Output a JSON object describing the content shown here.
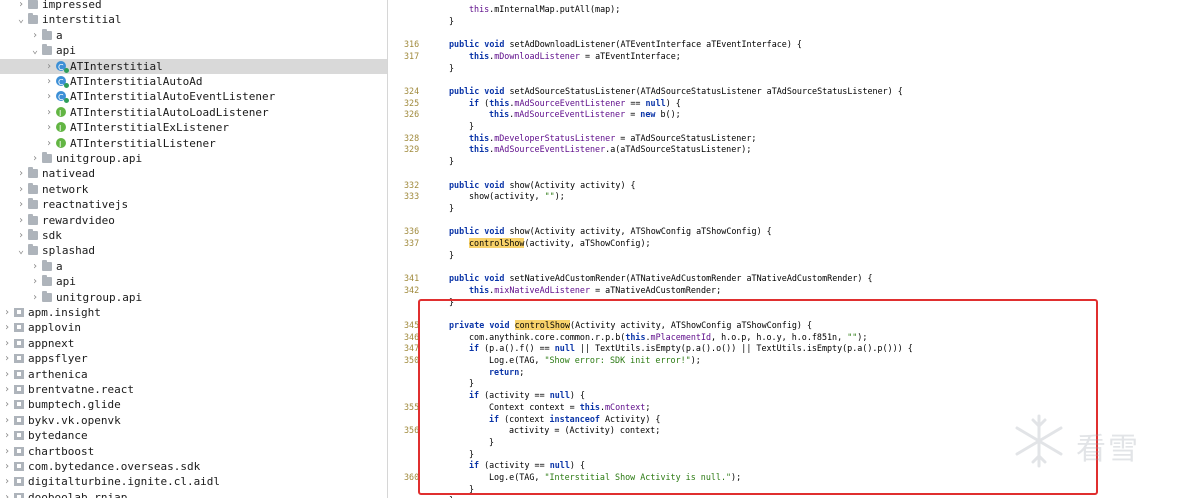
{
  "tree": {
    "rows": [
      {
        "label": "impressed",
        "indent": 1,
        "icon": "folder-icon",
        "chevron": ">"
      },
      {
        "label": "interstitial",
        "indent": 1,
        "icon": "folder-icon",
        "chevron": "v"
      },
      {
        "label": "a",
        "indent": 2,
        "icon": "folder-icon",
        "chevron": ">"
      },
      {
        "label": "api",
        "indent": 2,
        "icon": "folder-icon",
        "chevron": "v"
      },
      {
        "label": "ATInterstitial",
        "indent": 3,
        "icon": "class-icon",
        "chevron": ">",
        "selected": true
      },
      {
        "label": "ATInterstitialAutoAd",
        "indent": 3,
        "icon": "class-icon",
        "chevron": ">"
      },
      {
        "label": "ATInterstitialAutoEventListener",
        "indent": 3,
        "icon": "class-icon",
        "chevron": ">"
      },
      {
        "label": "ATInterstitialAutoLoadListener",
        "indent": 3,
        "icon": "interface-icon",
        "chevron": ">"
      },
      {
        "label": "ATInterstitialExListener",
        "indent": 3,
        "icon": "interface-icon",
        "chevron": ">"
      },
      {
        "label": "ATInterstitialListener",
        "indent": 3,
        "icon": "interface-icon",
        "chevron": ">"
      },
      {
        "label": "unitgroup.api",
        "indent": 2,
        "icon": "folder-icon",
        "chevron": ">"
      },
      {
        "label": "nativead",
        "indent": 1,
        "icon": "folder-icon",
        "chevron": ">"
      },
      {
        "label": "network",
        "indent": 1,
        "icon": "folder-icon",
        "chevron": ">"
      },
      {
        "label": "reactnativejs",
        "indent": 1,
        "icon": "folder-icon",
        "chevron": ">"
      },
      {
        "label": "rewardvideo",
        "indent": 1,
        "icon": "folder-icon",
        "chevron": ">"
      },
      {
        "label": "sdk",
        "indent": 1,
        "icon": "folder-icon",
        "chevron": ">"
      },
      {
        "label": "splashad",
        "indent": 1,
        "icon": "folder-icon",
        "chevron": "v"
      },
      {
        "label": "a",
        "indent": 2,
        "icon": "folder-icon",
        "chevron": ">"
      },
      {
        "label": "api",
        "indent": 2,
        "icon": "folder-icon",
        "chevron": ">"
      },
      {
        "label": "unitgroup.api",
        "indent": 2,
        "icon": "folder-icon",
        "chevron": ">"
      },
      {
        "label": "apm.insight",
        "indent": 0,
        "icon": "package-icon",
        "chevron": ">"
      },
      {
        "label": "applovin",
        "indent": 0,
        "icon": "package-icon",
        "chevron": ">"
      },
      {
        "label": "appnext",
        "indent": 0,
        "icon": "package-icon",
        "chevron": ">"
      },
      {
        "label": "appsflyer",
        "indent": 0,
        "icon": "package-icon",
        "chevron": ">"
      },
      {
        "label": "arthenica",
        "indent": 0,
        "icon": "package-icon",
        "chevron": ">"
      },
      {
        "label": "brentvatne.react",
        "indent": 0,
        "icon": "package-icon",
        "chevron": ">"
      },
      {
        "label": "bumptech.glide",
        "indent": 0,
        "icon": "package-icon",
        "chevron": ">"
      },
      {
        "label": "bykv.vk.openvk",
        "indent": 0,
        "icon": "package-icon",
        "chevron": ">"
      },
      {
        "label": "bytedance",
        "indent": 0,
        "icon": "package-icon",
        "chevron": ">"
      },
      {
        "label": "chartboost",
        "indent": 0,
        "icon": "package-icon",
        "chevron": ">"
      },
      {
        "label": "com.bytedance.overseas.sdk",
        "indent": 0,
        "icon": "package-icon",
        "chevron": ">"
      },
      {
        "label": "digitalturbine.ignite.cl.aidl",
        "indent": 0,
        "icon": "package-icon",
        "chevron": ">"
      },
      {
        "label": "dooboolab.rniap",
        "indent": 0,
        "icon": "package-icon",
        "chevron": ">"
      }
    ]
  },
  "editor": {
    "lines": [
      {
        "ln": "",
        "html": "<span class=\"fld\">this</span>.mInternalMap.putAll(map);",
        "indent": 2
      },
      {
        "ln": "",
        "html": "}",
        "indent": 1
      },
      {
        "ln": "",
        "html": "",
        "indent": 0
      },
      {
        "ln": "316",
        "html": "<span class=\"kw\">public void</span> setAdDownloadListener(ATEventInterface aTEventInterface) {",
        "indent": 1
      },
      {
        "ln": "317",
        "html": "<span class=\"kw\">this</span>.<span class=\"fld\">mDownloadListener</span> = aTEventInterface;",
        "indent": 2
      },
      {
        "ln": "",
        "html": "}",
        "indent": 1
      },
      {
        "ln": "",
        "html": "",
        "indent": 0
      },
      {
        "ln": "324",
        "html": "<span class=\"kw\">public void</span> setAdSourceStatusListener(ATAdSourceStatusListener aTAdSourceStatusListener) {",
        "indent": 1
      },
      {
        "ln": "325",
        "html": "<span class=\"kw\">if</span> (<span class=\"kw\">this</span>.<span class=\"fld\">mAdSourceEventListener</span> == <span class=\"kw\">null</span>) {",
        "indent": 2
      },
      {
        "ln": "326",
        "html": "<span class=\"kw\">this</span>.<span class=\"fld\">mAdSourceEventListener</span> = <span class=\"kw\">new</span> b();",
        "indent": 3
      },
      {
        "ln": "",
        "html": "}",
        "indent": 2
      },
      {
        "ln": "328",
        "html": "<span class=\"kw\">this</span>.<span class=\"fld\">mDeveloperStatusListener</span> = aTAdSourceStatusListener;",
        "indent": 2
      },
      {
        "ln": "329",
        "html": "<span class=\"kw\">this</span>.<span class=\"fld\">mAdSourceEventListener</span>.a(aTAdSourceStatusListener);",
        "indent": 2
      },
      {
        "ln": "",
        "html": "}",
        "indent": 1
      },
      {
        "ln": "",
        "html": "",
        "indent": 0
      },
      {
        "ln": "332",
        "html": "<span class=\"kw\">public void</span> show(Activity activity) {",
        "indent": 1
      },
      {
        "ln": "333",
        "html": "show(activity, <span class=\"str\">\"\"</span>);",
        "indent": 2
      },
      {
        "ln": "",
        "html": "}",
        "indent": 1
      },
      {
        "ln": "",
        "html": "",
        "indent": 0
      },
      {
        "ln": "336",
        "html": "<span class=\"kw\">public void</span> show(Activity activity, ATShowConfig aTShowConfig) {",
        "indent": 1
      },
      {
        "ln": "337",
        "html": "<span class=\"hl\">controlShow</span>(activity, aTShowConfig);",
        "indent": 2
      },
      {
        "ln": "",
        "html": "}",
        "indent": 1
      },
      {
        "ln": "",
        "html": "",
        "indent": 0
      },
      {
        "ln": "341",
        "html": "<span class=\"kw\">public void</span> setNativeAdCustomRender(ATNativeAdCustomRender aTNativeAdCustomRender) {",
        "indent": 1
      },
      {
        "ln": "342",
        "html": "<span class=\"kw\">this</span>.<span class=\"fld\">mixNativeAdListener</span> = aTNativeAdCustomRender;",
        "indent": 2
      },
      {
        "ln": "",
        "html": "}",
        "indent": 1
      },
      {
        "ln": "",
        "html": "",
        "indent": 0
      },
      {
        "ln": "345",
        "html": "<span class=\"kw\">private void</span> <span class=\"hl\">controlShow</span>(Activity activity, ATShowConfig aTShowConfig) {",
        "indent": 1
      },
      {
        "ln": "346",
        "html": "com.anythink.core.common.r.p.b(<span class=\"kw\">this</span>.<span class=\"fld\">mPlacementId</span>, h.o.p, h.o.y, h.o.f851n, <span class=\"str\">\"\"</span>);",
        "indent": 2
      },
      {
        "ln": "347",
        "html": "<span class=\"kw\">if</span> (p.a().f() == <span class=\"kw\">null</span> || TextUtils.isEmpty(p.a().o()) || TextUtils.isEmpty(p.a().p())) {",
        "indent": 2
      },
      {
        "ln": "350",
        "html": "Log.e(TAG, <span class=\"str\">\"Show error: SDK init error!\"</span>);",
        "indent": 3
      },
      {
        "ln": "",
        "html": "<span class=\"kw\">return</span>;",
        "indent": 3
      },
      {
        "ln": "",
        "html": "}",
        "indent": 2
      },
      {
        "ln": "",
        "html": "<span class=\"kw\">if</span> (activity == <span class=\"kw\">null</span>) {",
        "indent": 2
      },
      {
        "ln": "355",
        "html": "Context context = <span class=\"kw\">this</span>.<span class=\"fld\">mContext</span>;",
        "indent": 3
      },
      {
        "ln": "",
        "html": "<span class=\"kw\">if</span> (context <span class=\"kw\">instanceof</span> Activity) {",
        "indent": 3
      },
      {
        "ln": "356",
        "html": "activity = (Activity) context;",
        "indent": 4
      },
      {
        "ln": "",
        "html": "}",
        "indent": 3
      },
      {
        "ln": "",
        "html": "}",
        "indent": 2
      },
      {
        "ln": "",
        "html": "<span class=\"kw\">if</span> (activity == <span class=\"kw\">null</span>) {",
        "indent": 2
      },
      {
        "ln": "360",
        "html": "Log.e(TAG, <span class=\"str\">\"Interstitial Show Activity is null.\"</span>);",
        "indent": 3
      },
      {
        "ln": "",
        "html": "}",
        "indent": 2
      },
      {
        "ln": "",
        "html": "}",
        "indent": 1
      }
    ]
  },
  "watermark": {
    "text": "看雪"
  },
  "colors": {
    "highlight": "#f8d26a",
    "annotation_box": "#e02f2f",
    "keyword": "#0b35a8"
  }
}
